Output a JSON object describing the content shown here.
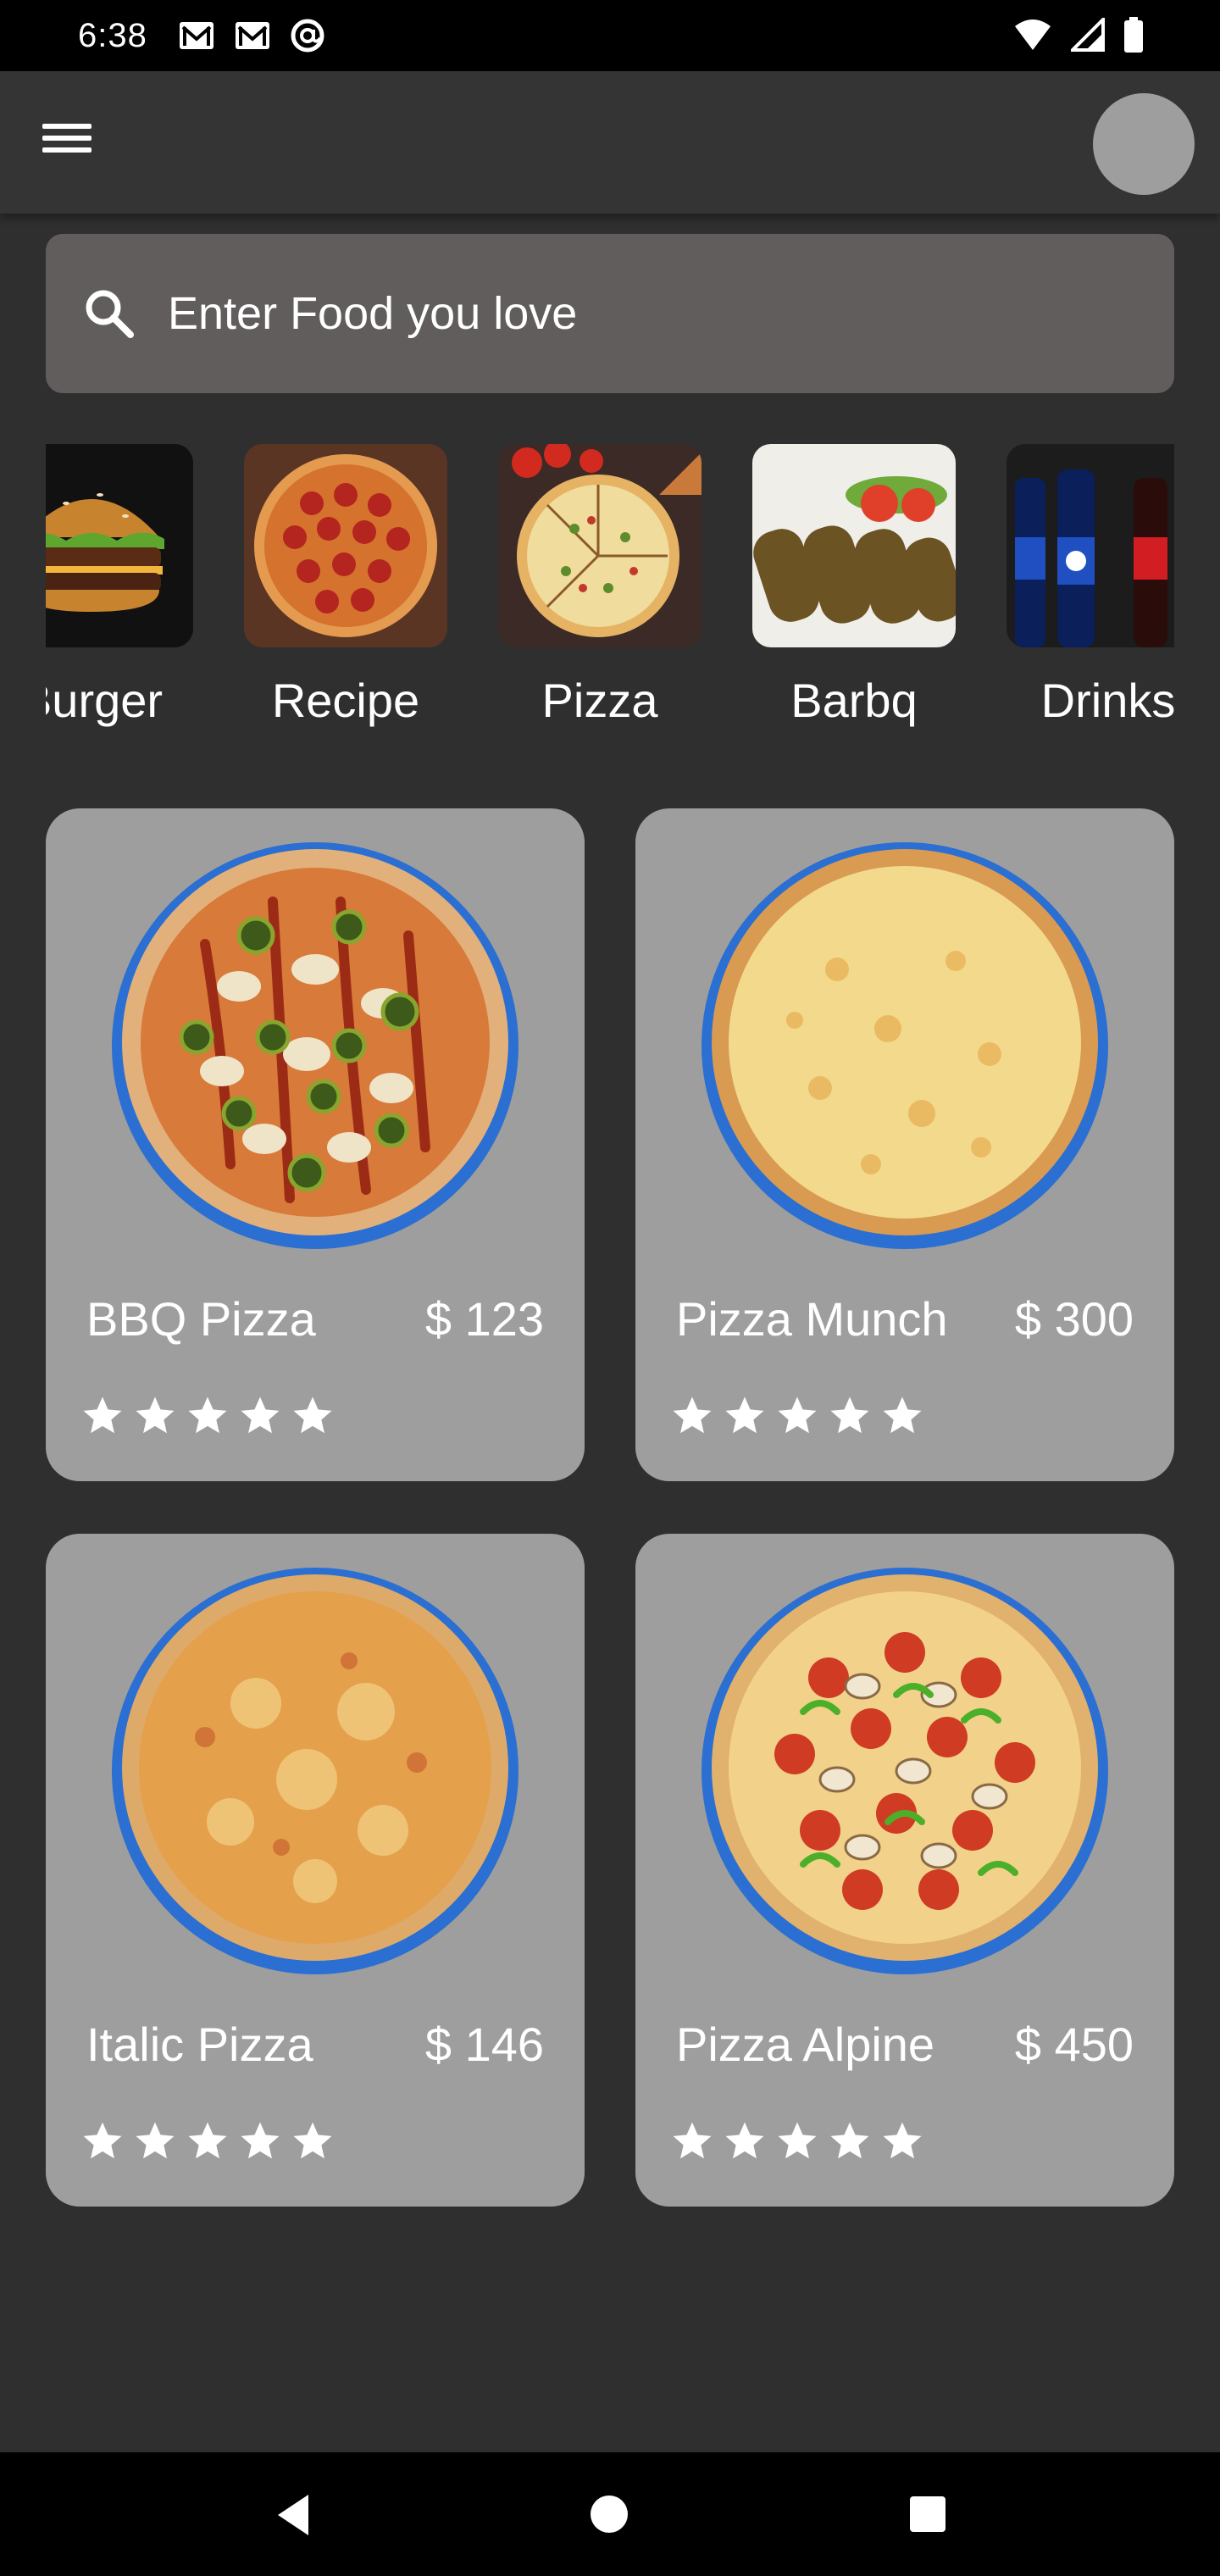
{
  "status_bar": {
    "time": "6:38",
    "left_icons": [
      "gmail-icon",
      "gmail-icon",
      "at-sign-icon"
    ],
    "right_icons": [
      "wifi-icon",
      "cell-signal-icon",
      "battery-icon"
    ]
  },
  "app_bar": {
    "menu_icon": "hamburger-menu-icon",
    "avatar_color": "#9e9e9e"
  },
  "search": {
    "placeholder": "Enter Food you love",
    "icon": "search-icon"
  },
  "categories": [
    {
      "label": "Burger"
    },
    {
      "label": "Recipe"
    },
    {
      "label": "Pizza"
    },
    {
      "label": "Barbq"
    },
    {
      "label": "Drinks"
    }
  ],
  "foods": [
    {
      "name": "BBQ Pizza",
      "price": "$ 123",
      "rating": 5
    },
    {
      "name": "Pizza Munch",
      "price": "$ 300",
      "rating": 5
    },
    {
      "name": "Italic Pizza",
      "price": "$ 146",
      "rating": 5
    },
    {
      "name": "Pizza Alpine",
      "price": "$ 450",
      "rating": 5
    }
  ],
  "colors": {
    "background": "#2f2f2f",
    "app_bar": "#343434",
    "search_box": "#625d5d",
    "card": "#9e9e9e",
    "plate_blue": "#2a6fd1"
  },
  "nav_bar": {
    "icons": [
      "back-icon",
      "home-icon",
      "recents-icon"
    ]
  }
}
